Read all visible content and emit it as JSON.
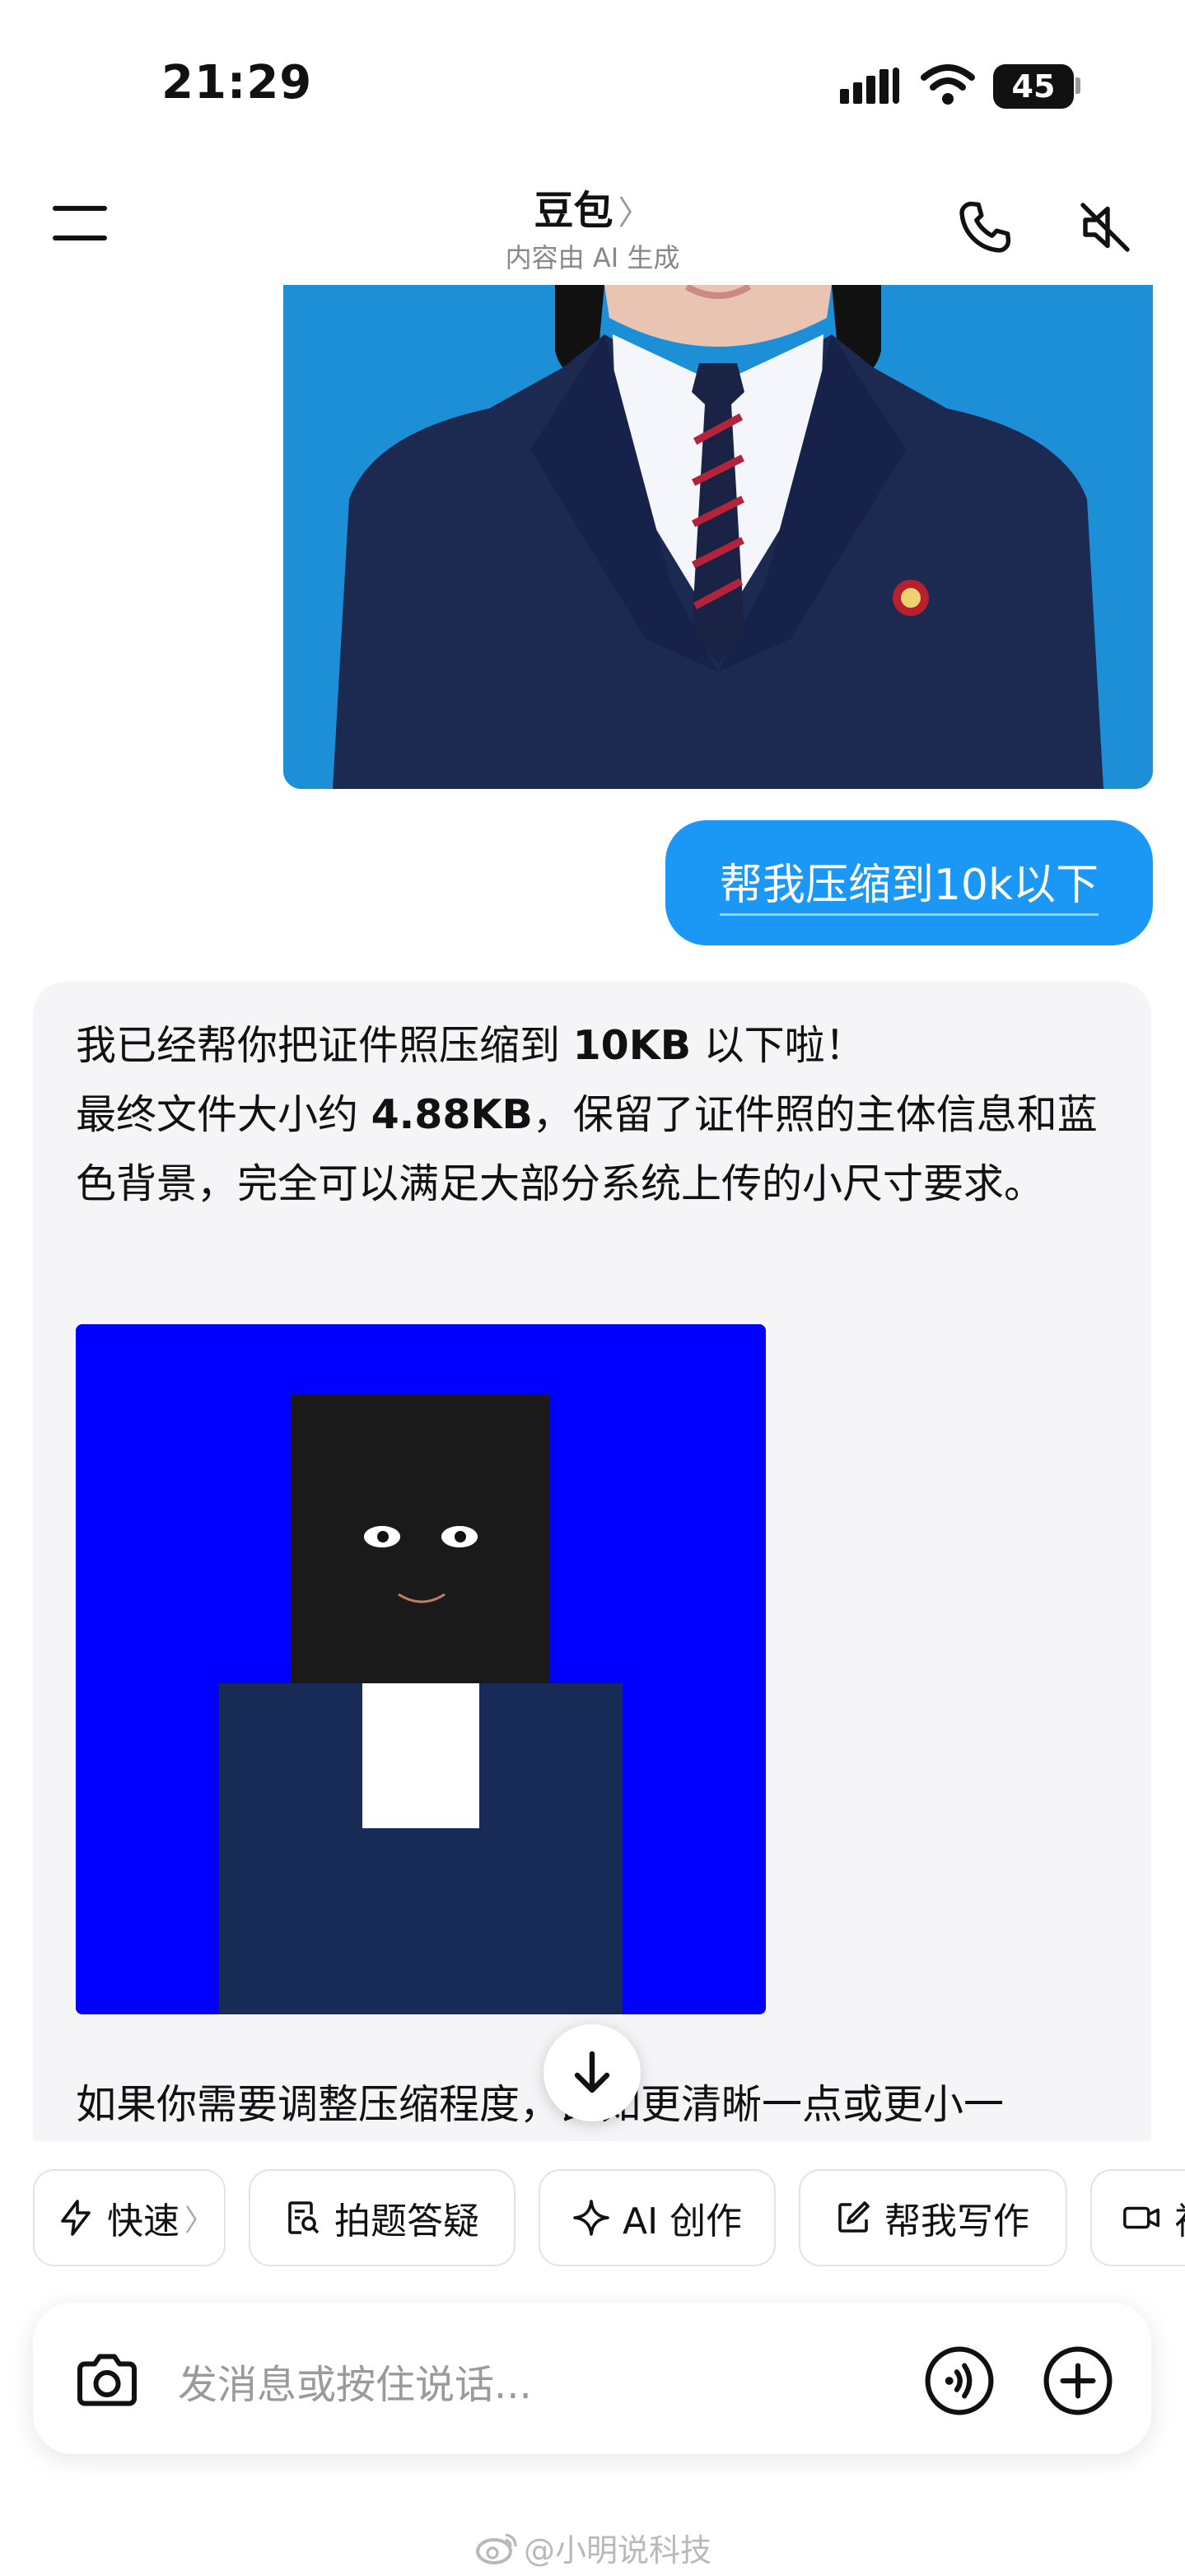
{
  "status_bar": {
    "time": "21:29",
    "battery": "45"
  },
  "header": {
    "title": "豆包",
    "title_chevron": "〉",
    "subtitle": "内容由 AI 生成"
  },
  "user_message": {
    "text": "帮我压缩到10k以下"
  },
  "ai_message": {
    "line1_a": "我已经帮你把证件照压缩到 ",
    "line1_b": "10KB",
    "line1_c": " 以下啦！",
    "line2_a": "最终文件大小约 ",
    "line2_b": "4.88KB",
    "line2_c": "，保留了证件照的主体信息和蓝色背景，完全可以满足大部分系统上传的小尺寸要求。",
    "follow_text": "如果你需要调整压缩程度，比如更清晰一点或更小一"
  },
  "quick_actions": [
    {
      "label": "快速",
      "icon": "lightning-icon",
      "chevron": "〉"
    },
    {
      "label": "拍题答疑",
      "icon": "doc-search-icon"
    },
    {
      "label": "AI 创作",
      "icon": "sparkle-icon"
    },
    {
      "label": "帮我写作",
      "icon": "edit-icon"
    },
    {
      "label": "视",
      "icon": "video-icon"
    }
  ],
  "input": {
    "placeholder": "发消息或按住说话..."
  },
  "watermark": "@小明说科技",
  "colors": {
    "accent_blue": "#1b97f5",
    "photo_background": "#1d8fd7",
    "generated_background": "#0000ff",
    "suit_navy": "#182a56"
  }
}
